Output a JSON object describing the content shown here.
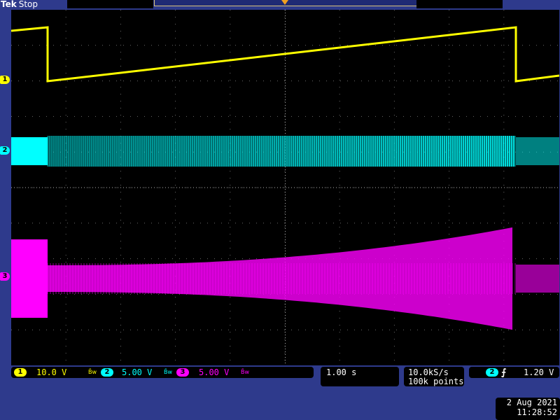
{
  "header": {
    "brand": "Tek",
    "acquisition_state": "Stop"
  },
  "channels": [
    {
      "id": "1",
      "scale": "10.0 V",
      "color": "#ffff00",
      "bandwidth_icon": "bandwidth-limit-icon"
    },
    {
      "id": "2",
      "scale": "5.00 V",
      "color": "#00ffff",
      "bandwidth_icon": "bandwidth-limit-icon"
    },
    {
      "id": "3",
      "scale": "5.00 V",
      "color": "#ff00ff",
      "bandwidth_icon": "bandwidth-limit-icon"
    }
  ],
  "markers": {
    "ch1": "1",
    "ch2": "2",
    "ch3": "3"
  },
  "horizontal": {
    "time_per_div": "1.00 s"
  },
  "acquisition": {
    "sample_rate": "10.0kS/s",
    "record_length": "100k points"
  },
  "trigger": {
    "source": "2",
    "slope_icon": "rising-edge-icon",
    "level": "1.20 V"
  },
  "datetime": {
    "date": "2 Aug 2021",
    "time": "11:28:52"
  },
  "colors": {
    "background": "#2e3a8c",
    "screen": "#000000",
    "ch1": "#ffff00",
    "ch2": "#00ffff",
    "ch3": "#ff00ff",
    "trigger_marker": "#f0a020"
  }
}
